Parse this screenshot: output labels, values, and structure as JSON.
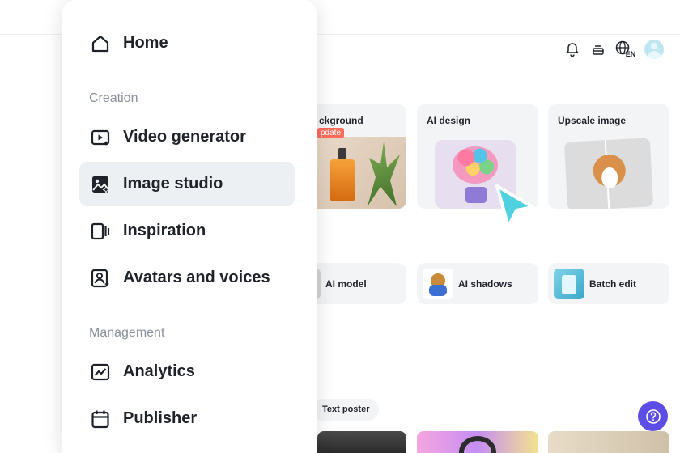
{
  "topbar": {
    "icons": [
      "bell-icon",
      "stack-icon",
      "globe-icon",
      "avatar"
    ],
    "lang_label": "EN"
  },
  "feature_cards": [
    {
      "title": "ckground",
      "badge": "pdate"
    },
    {
      "title": "AI design"
    },
    {
      "title": "Upscale image"
    }
  ],
  "tools": [
    {
      "label": "AI model"
    },
    {
      "label": "AI shadows"
    },
    {
      "label": "Batch edit"
    }
  ],
  "chips": {
    "text_poster": "Text poster"
  },
  "sidebar": {
    "home": "Home",
    "section_creation": "Creation",
    "items_creation": [
      {
        "label": "Video generator",
        "icon": "video-generator-icon"
      },
      {
        "label": "Image studio",
        "icon": "image-studio-icon",
        "active": true
      },
      {
        "label": "Inspiration",
        "icon": "inspiration-icon"
      },
      {
        "label": "Avatars and voices",
        "icon": "avatar-voice-icon"
      }
    ],
    "section_management": "Management",
    "items_management": [
      {
        "label": "Analytics",
        "icon": "analytics-icon"
      },
      {
        "label": "Publisher",
        "icon": "calendar-icon"
      }
    ]
  },
  "colors": {
    "accent": "#5b4de6",
    "badge": "#ff6b5b",
    "active_bg": "#edf0f2",
    "cursor": "#4fd1e0"
  }
}
